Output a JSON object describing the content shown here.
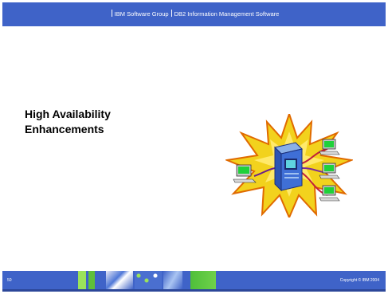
{
  "header": {
    "group": "IBM Software Group",
    "product": "DB2 Information Management Software"
  },
  "title": {
    "line1": "High Availability",
    "line2": "Enhancements"
  },
  "clipart": {
    "icon": "server-network-icon",
    "burst_color": "#f2d21d",
    "burst_outline": "#e06a00"
  },
  "footer": {
    "page_number": "50",
    "copyright": "Copyright © IBM 2004"
  },
  "colors": {
    "header_bg": "#3f63c8",
    "footer_bg": "#3f63c8"
  }
}
